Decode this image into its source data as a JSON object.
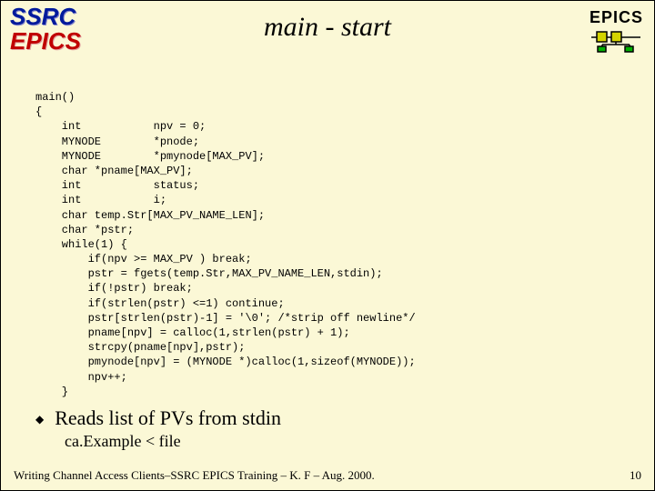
{
  "header": {
    "logo_ssrc": "SSRC",
    "logo_epics": "EPICS",
    "title": "main - start",
    "right_label": "EPICS"
  },
  "code": "main()\n{\n    int           npv = 0;\n    MYNODE        *pnode;\n    MYNODE        *pmynode[MAX_PV];\n    char *pname[MAX_PV];\n    int           status;\n    int           i;\n    char temp.Str[MAX_PV_NAME_LEN];\n    char *pstr;\n    while(1) {\n        if(npv >= MAX_PV ) break;\n        pstr = fgets(temp.Str,MAX_PV_NAME_LEN,stdin);\n        if(!pstr) break;\n        if(strlen(pstr) <=1) continue;\n        pstr[strlen(pstr)-1] = '\\0'; /*strip off newline*/\n        pname[npv] = calloc(1,strlen(pstr) + 1);\n        strcpy(pname[npv],pstr);\n        pmynode[npv] = (MYNODE *)calloc(1,sizeof(MYNODE));\n        npv++;\n    }",
  "bullet": {
    "text": "Reads list of PVs from stdin",
    "sub": "ca.Example < file"
  },
  "footer": {
    "left": "Writing Channel Access Clients–SSRC EPICS Training – K. F – Aug. 2000.",
    "right": "10"
  },
  "icon_colors": {
    "tl": "#d4d400",
    "tr": "#d4d400",
    "bl": "#00b000",
    "br": "#00b000"
  }
}
